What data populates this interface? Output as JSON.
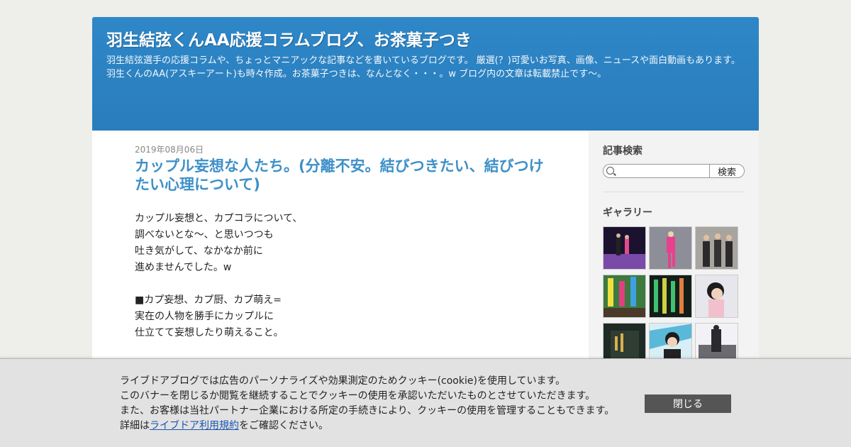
{
  "header": {
    "title": "羽生結弦くんAA応援コラムブログ、お茶菓子つき",
    "description": "羽生結弦選手の応援コラムや、ちょっとマニアックな記事などを書いているブログです。 厳選(？)可愛いお写真、画像、ニュースや面白動画もあります。羽生くんのAA(アスキーアート)も時々作成。お茶菓子つきは、なんとなく・・・。w ブログ内の文章は転載禁止です～。"
  },
  "post": {
    "date": "2019年08月06日",
    "title": "カップル妄想な人たち。(分離不安。結びつきたい、結びつけたい心理について)",
    "lines": [
      "カップル妄想と、カプコラについて、",
      "調べないとな～、と思いつつも",
      "吐き気がして、なかなか前に",
      "進めませんでした。w",
      "",
      "■カプ妄想、カプ厨、カプ萌え=",
      "実在の人物を勝手にカップルに",
      "仕立てて妄想したり萌えること。"
    ]
  },
  "sidebar": {
    "search_heading": "記事検索",
    "search_value": "",
    "search_button": "検索",
    "gallery_heading": "ギャラリー"
  },
  "cookie": {
    "line1": "ライブドアブログでは広告のパーソナライズや効果測定のためクッキー(cookie)を使用しています。",
    "line2": "このバナーを閉じるか閲覧を継続することでクッキーの使用を承認いただいたものとさせていただきます。",
    "line3": "また、お客様は当社パートナー企業における所定の手続きにより、クッキーの使用を管理することもできます。",
    "line4_prefix": "詳細は",
    "terms_link": "ライブドア利用規約",
    "line4_suffix": "をご確認ください。",
    "close_button": "閉じる"
  },
  "colors": {
    "header_bg": "#2e87c8",
    "post_title": "#3d90c8",
    "link": "#1a56b0",
    "close_button_bg": "#555555"
  }
}
